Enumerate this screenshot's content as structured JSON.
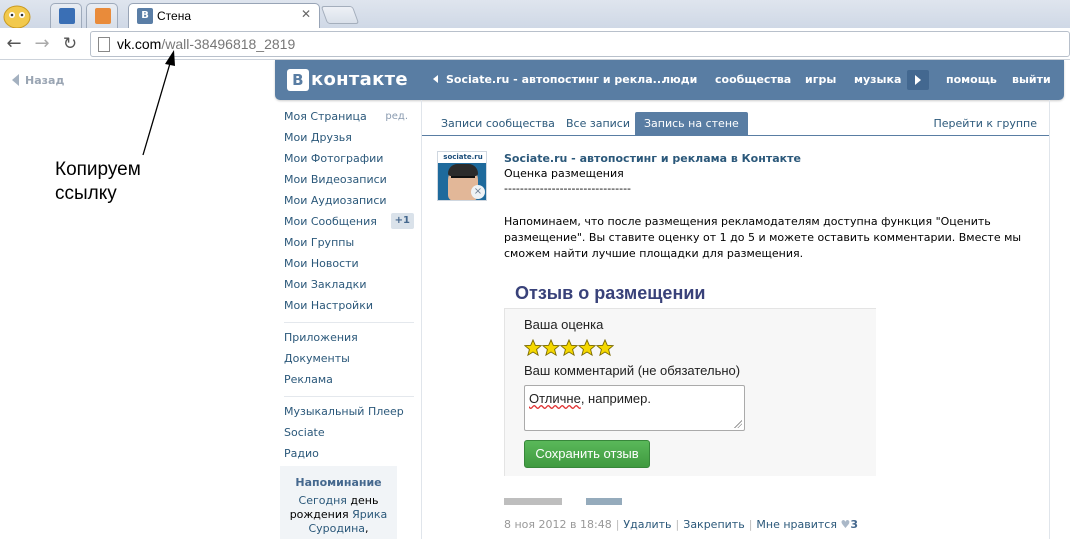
{
  "browser": {
    "tabs": [
      {
        "title": ""
      },
      {
        "title": ""
      },
      {
        "title": "Стена"
      }
    ],
    "url_domain": "vk.com",
    "url_path": "/wall-38496818_2819"
  },
  "annotation": {
    "back_label": "Назад",
    "line1": "Копируем",
    "line2": "ссылку"
  },
  "header": {
    "logo_box": "В",
    "logo_word": "контакте",
    "nav": {
      "ticker": "Sociate.ru - автопостинг и рекла...",
      "people": "люди",
      "communities": "сообщества",
      "games": "игры",
      "music": "музыка",
      "help": "помощь",
      "logout": "выйти"
    }
  },
  "left_menu": {
    "group1": [
      {
        "label": "Моя Страница",
        "extra": "ред."
      },
      {
        "label": "Мои Друзья"
      },
      {
        "label": "Мои Фотографии"
      },
      {
        "label": "Мои Видеозаписи"
      },
      {
        "label": "Мои Аудиозаписи"
      },
      {
        "label": "Мои Сообщения",
        "badge": "+1"
      },
      {
        "label": "Мои Группы"
      },
      {
        "label": "Мои Новости"
      },
      {
        "label": "Мои Закладки"
      },
      {
        "label": "Мои Настройки"
      }
    ],
    "group2": [
      {
        "label": "Приложения"
      },
      {
        "label": "Документы"
      },
      {
        "label": "Реклама"
      }
    ],
    "group3": [
      {
        "label": "Музыкальный Плеер"
      },
      {
        "label": "Sociate"
      },
      {
        "label": "Радио"
      }
    ],
    "reminder": {
      "title": "Напоминание",
      "today": "Сегодня",
      "text1": " день",
      "text2": "рождения ",
      "name1": "Ярика",
      "name2": "Суродина",
      "tail": ","
    }
  },
  "content_tabs": {
    "tab1": "Записи сообщества",
    "tab2": "Все записи",
    "tab3": "Запись на стене",
    "group_link": "Перейти к группе"
  },
  "post": {
    "avatar_label": "sociate.ru",
    "remove_glyph": "×",
    "author": "Sociate.ru - автопостинг и реклама в Контакте",
    "subtitle": "Оценка размещения",
    "divider": "--------------------------------",
    "text": "Напоминаем, что после размещения рекламодателям доступна функция \"Оценить размещение\". Вы ставите оценку от 1 до 5 и можете оставить комментарии. Вместе мы сможем найти лучшие площадки для размещения.",
    "review": {
      "heading": "Отзыв о размещении",
      "rating_label": "Ваша оценка",
      "rating": 5,
      "rating_max": 5,
      "comment_label": "Ваш комментарий (не обязательно)",
      "comment_word1": "Отличне",
      "comment_rest": ", например.",
      "save_button": "Сохранить отзыв"
    },
    "meta": {
      "date": "8 ноя 2012 в 18:48",
      "delete": "Удалить",
      "pin": "Закрепить",
      "like": "Мне нравится",
      "heart": "♥",
      "likes_count": "3"
    }
  },
  "colors": {
    "vk_blue": "#597da3",
    "link": "#2b587a",
    "button_green": "#4aa84a",
    "star": "#f5d800"
  }
}
